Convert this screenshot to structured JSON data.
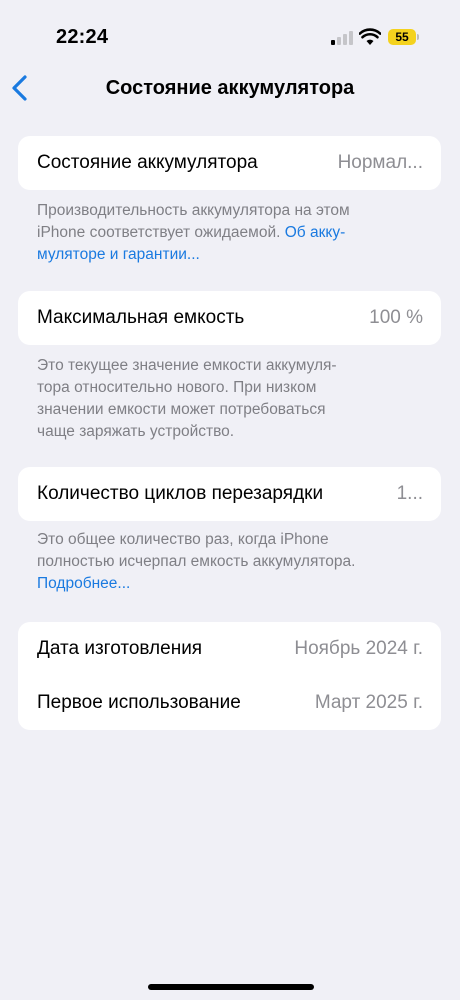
{
  "status_bar": {
    "time": "22:24",
    "battery_level": "55"
  },
  "nav": {
    "title": "Состояние аккумулятора"
  },
  "battery_health": {
    "label": "Состояние аккумулятора",
    "value": "Нормал...",
    "footnote_line1": "Производительность аккумулятора на этом",
    "footnote_line2_text": "iPhone соответствует ожидаемой.",
    "footnote_link_part1": "Об акку-",
    "footnote_link_part2": "муляторе и гарантии..."
  },
  "max_capacity": {
    "label": "Максимальная емкость",
    "value": "100 %",
    "footnote_line1": "Это текущее значение емкости аккумуля-",
    "footnote_line2": "тора относительно нового. При низком",
    "footnote_line3": "значении емкости может потребоваться",
    "footnote_line4": "чаще заряжать устройство."
  },
  "cycle_count": {
    "label": "Количество циклов перезарядки",
    "value": "1...",
    "footnote_line1": "Это общее количество раз, когда iPhone",
    "footnote_line2": "полностью исчерпал емкость аккумулятора.",
    "footnote_link": "Подробнее..."
  },
  "dates": {
    "manufacture_label": "Дата изготовления",
    "manufacture_value": "Ноябрь 2024 г.",
    "first_use_label": "Первое использование",
    "first_use_value": "Март 2025 г."
  },
  "colors": {
    "accent": "#1a7ae0",
    "background": "#f0f0f6",
    "battery": "#f4d21e"
  }
}
